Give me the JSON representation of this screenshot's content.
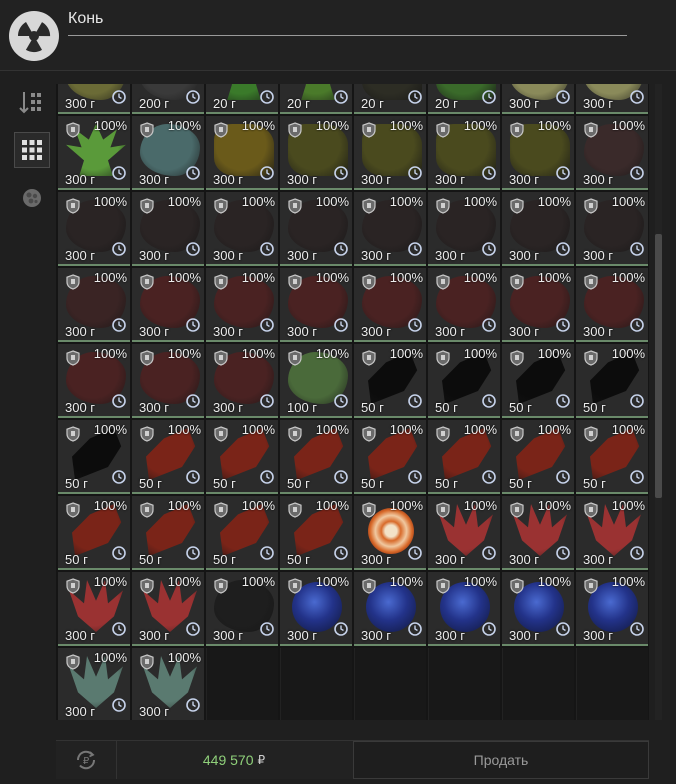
{
  "title": "Конь",
  "footer": {
    "balance": "449 570",
    "currency": "₽",
    "sell_label": "Продать"
  },
  "colors": {
    "balance": "#8fd07a",
    "cell_underline": "#6a8a6a"
  },
  "sidebar": {
    "items": [
      {
        "icon": "sort-icon",
        "active": false
      },
      {
        "icon": "grid-view-icon",
        "active": true
      },
      {
        "icon": "artifact-filter-icon",
        "active": false
      }
    ]
  },
  "items": [
    {
      "pct": "",
      "weight": "300 г",
      "shape": "blob",
      "color": "#6b6b36"
    },
    {
      "pct": "",
      "weight": "200 г",
      "shape": "blob",
      "color": "#3a3a3a"
    },
    {
      "pct": "",
      "weight": "20 г",
      "shape": "plant",
      "color": "#3a7a2a"
    },
    {
      "pct": "",
      "weight": "20 г",
      "shape": "plant",
      "color": "#4a7a2a"
    },
    {
      "pct": "",
      "weight": "20 г",
      "shape": "chunk",
      "color": "#2d2d24"
    },
    {
      "pct": "",
      "weight": "20 г",
      "shape": "chunk",
      "color": "#3a6a2a"
    },
    {
      "pct": "",
      "weight": "300 г",
      "shape": "blob",
      "color": "#8a8a5a"
    },
    {
      "pct": "",
      "weight": "300 г",
      "shape": "blob",
      "color": "#8a8a5a"
    },
    {
      "pct": "100%",
      "weight": "300 г",
      "shape": "plant",
      "color": "#5a9a3a"
    },
    {
      "pct": "100%",
      "weight": "300 г",
      "shape": "blob",
      "color": "#4a6a6a"
    },
    {
      "pct": "100%",
      "weight": "300 г",
      "shape": "chunk",
      "color": "#6a5a1a"
    },
    {
      "pct": "100%",
      "weight": "300 г",
      "shape": "chunk",
      "color": "#4a4a1e"
    },
    {
      "pct": "100%",
      "weight": "300 г",
      "shape": "chunk",
      "color": "#4a4a1e"
    },
    {
      "pct": "100%",
      "weight": "300 г",
      "shape": "chunk",
      "color": "#4a4a1e"
    },
    {
      "pct": "100%",
      "weight": "300 г",
      "shape": "chunk",
      "color": "#4a4a1e"
    },
    {
      "pct": "100%",
      "weight": "300 г",
      "shape": "blob",
      "color": "#3a2a2a"
    },
    {
      "pct": "100%",
      "weight": "300 г",
      "shape": "blob",
      "color": "#2a2424"
    },
    {
      "pct": "100%",
      "weight": "300 г",
      "shape": "blob",
      "color": "#2a2424"
    },
    {
      "pct": "100%",
      "weight": "300 г",
      "shape": "blob",
      "color": "#2a2424"
    },
    {
      "pct": "100%",
      "weight": "300 г",
      "shape": "blob",
      "color": "#2a2424"
    },
    {
      "pct": "100%",
      "weight": "300 г",
      "shape": "blob",
      "color": "#2a2424"
    },
    {
      "pct": "100%",
      "weight": "300 г",
      "shape": "blob",
      "color": "#2a2424"
    },
    {
      "pct": "100%",
      "weight": "300 г",
      "shape": "blob",
      "color": "#2a2424"
    },
    {
      "pct": "100%",
      "weight": "300 г",
      "shape": "blob",
      "color": "#2a2424"
    },
    {
      "pct": "100%",
      "weight": "300 г",
      "shape": "blob",
      "color": "#3a2424"
    },
    {
      "pct": "100%",
      "weight": "300 г",
      "shape": "blob",
      "color": "#4a2222"
    },
    {
      "pct": "100%",
      "weight": "300 г",
      "shape": "blob",
      "color": "#4a2222"
    },
    {
      "pct": "100%",
      "weight": "300 г",
      "shape": "blob",
      "color": "#4a2222"
    },
    {
      "pct": "100%",
      "weight": "300 г",
      "shape": "blob",
      "color": "#4a2222"
    },
    {
      "pct": "100%",
      "weight": "300 г",
      "shape": "blob",
      "color": "#4a2222"
    },
    {
      "pct": "100%",
      "weight": "300 г",
      "shape": "blob",
      "color": "#4a2222"
    },
    {
      "pct": "100%",
      "weight": "300 г",
      "shape": "blob",
      "color": "#4a2222"
    },
    {
      "pct": "100%",
      "weight": "300 г",
      "shape": "blob",
      "color": "#4a2222"
    },
    {
      "pct": "100%",
      "weight": "300 г",
      "shape": "blob",
      "color": "#4a2222"
    },
    {
      "pct": "100%",
      "weight": "300 г",
      "shape": "blob",
      "color": "#4a2222"
    },
    {
      "pct": "100%",
      "weight": "100 г",
      "shape": "blob",
      "color": "#4a6a3a"
    },
    {
      "pct": "100%",
      "weight": "50 г",
      "shape": "shard",
      "color": "#0c0c0c"
    },
    {
      "pct": "100%",
      "weight": "50 г",
      "shape": "shard",
      "color": "#0c0c0c"
    },
    {
      "pct": "100%",
      "weight": "50 г",
      "shape": "shard",
      "color": "#0c0c0c"
    },
    {
      "pct": "100%",
      "weight": "50 г",
      "shape": "shard",
      "color": "#0c0c0c"
    },
    {
      "pct": "100%",
      "weight": "50 г",
      "shape": "shard",
      "color": "#0c0c0c"
    },
    {
      "pct": "100%",
      "weight": "50 г",
      "shape": "shard",
      "color": "#7a2418"
    },
    {
      "pct": "100%",
      "weight": "50 г",
      "shape": "shard",
      "color": "#7a2418"
    },
    {
      "pct": "100%",
      "weight": "50 г",
      "shape": "shard",
      "color": "#7a2418"
    },
    {
      "pct": "100%",
      "weight": "50 г",
      "shape": "shard",
      "color": "#7a2418"
    },
    {
      "pct": "100%",
      "weight": "50 г",
      "shape": "shard",
      "color": "#7a2418"
    },
    {
      "pct": "100%",
      "weight": "50 г",
      "shape": "shard",
      "color": "#7a2418"
    },
    {
      "pct": "100%",
      "weight": "50 г",
      "shape": "shard",
      "color": "#7a2418"
    },
    {
      "pct": "100%",
      "weight": "50 г",
      "shape": "shard",
      "color": "#7a2418"
    },
    {
      "pct": "100%",
      "weight": "50 г",
      "shape": "shard",
      "color": "#7a2418"
    },
    {
      "pct": "100%",
      "weight": "50 г",
      "shape": "shard",
      "color": "#7a2418"
    },
    {
      "pct": "100%",
      "weight": "50 г",
      "shape": "shard",
      "color": "#7a2418"
    },
    {
      "pct": "100%",
      "weight": "300 г",
      "shape": "ring",
      "color": "#d86a2a"
    },
    {
      "pct": "100%",
      "weight": "300 г",
      "shape": "spiky",
      "color": "#9a3232"
    },
    {
      "pct": "100%",
      "weight": "300 г",
      "shape": "spiky",
      "color": "#9a3232"
    },
    {
      "pct": "100%",
      "weight": "300 г",
      "shape": "spiky",
      "color": "#9a3232"
    },
    {
      "pct": "100%",
      "weight": "300 г",
      "shape": "spiky",
      "color": "#9a3232"
    },
    {
      "pct": "100%",
      "weight": "300 г",
      "shape": "spiky",
      "color": "#9a3232"
    },
    {
      "pct": "100%",
      "weight": "300 г",
      "shape": "blob",
      "color": "#1e1e1e"
    },
    {
      "pct": "100%",
      "weight": "300 г",
      "shape": "orb",
      "color": "#23338a"
    },
    {
      "pct": "100%",
      "weight": "300 г",
      "shape": "orb",
      "color": "#23338a"
    },
    {
      "pct": "100%",
      "weight": "300 г",
      "shape": "orb",
      "color": "#23338a"
    },
    {
      "pct": "100%",
      "weight": "300 г",
      "shape": "orb",
      "color": "#23338a"
    },
    {
      "pct": "100%",
      "weight": "300 г",
      "shape": "orb",
      "color": "#23338a"
    },
    {
      "pct": "100%",
      "weight": "300 г",
      "shape": "spiky",
      "color": "#5a7a70"
    },
    {
      "pct": "100%",
      "weight": "300 г",
      "shape": "spiky",
      "color": "#5a7a70"
    }
  ]
}
